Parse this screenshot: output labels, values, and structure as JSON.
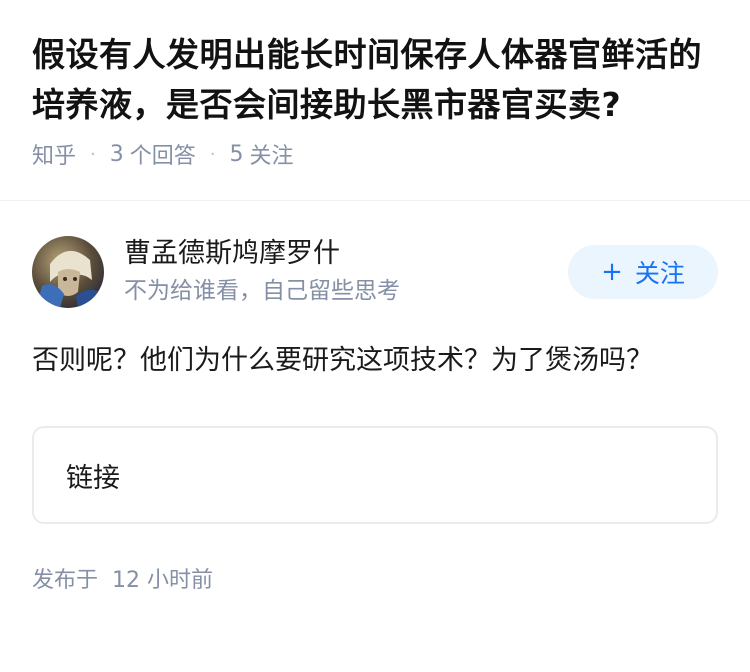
{
  "question": {
    "title": "假设有人发明出能长时间保存人体器官鲜活的培养液，是否会间接助长黑市器官买卖?",
    "source": "知乎",
    "answer_count": "3",
    "answer_label": "个回答",
    "follow_count": "5",
    "follow_label": "关注"
  },
  "answer": {
    "author_name": "曹孟德斯鸠摩罗什",
    "author_bio": "不为给谁看，自己留些思考",
    "follow_button_label": "关注",
    "follow_button_icon": "+",
    "content": "否则呢？他们为什么要研究这项技术？为了煲汤吗？",
    "link_label": "链接",
    "publish_prefix": "发布于",
    "publish_time": "12 小时前"
  },
  "colors": {
    "accent": "#1772f6",
    "follow_button_bg": "#ebf5fd",
    "meta_gray": "#8590a6"
  }
}
